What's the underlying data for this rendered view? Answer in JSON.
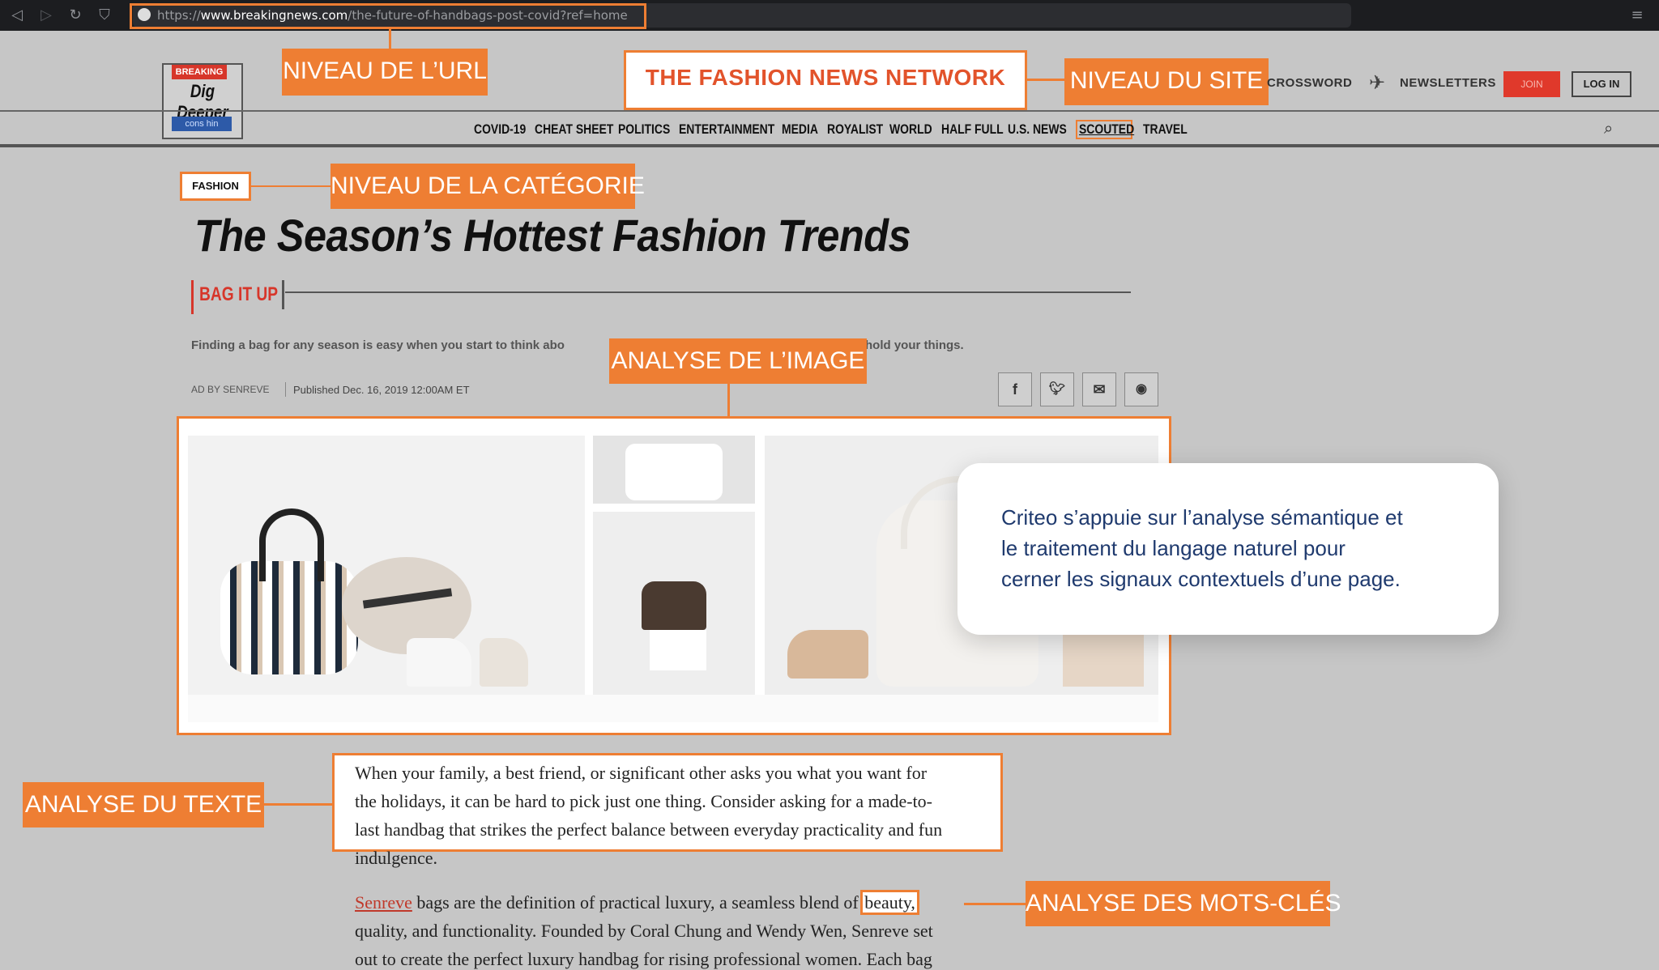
{
  "browser": {
    "url_prefix": "https://",
    "url_domain": "www.breakingnews.com",
    "url_path": "/the-future-of-handbags-post-covid?ref=home",
    "icons": [
      "back-icon",
      "forward-icon",
      "reload-icon",
      "bookmark-icon",
      "globe-icon",
      "menu-icon"
    ]
  },
  "logo": {
    "top": "BREAKING",
    "main": "Dig Deeper",
    "sub": "cons hin"
  },
  "header": {
    "site_name": "THE FASHION NEWS NETWORK",
    "crossword": "CROSSWORD",
    "newsletters": "NEWSLETTERS",
    "join": "JOIN",
    "login": "LOG IN"
  },
  "sections": [
    "COVID-19",
    "CHEAT SHEET",
    "POLITICS",
    "ENTERTAINMENT",
    "MEDIA",
    "ROYALIST",
    "WORLD",
    "HALF FULL",
    "U.S. NEWS",
    "SCOUTED",
    "TRAVEL"
  ],
  "article": {
    "category": "FASHION",
    "title": "The Season’s Hottest Fashion Trends",
    "rubric": "BAG IT UP",
    "dek_left": "Finding a bag for any season is easy when you start to think abo",
    "dek_right": "hold your things.",
    "ad_by": "AD BY SENREVE",
    "published": "Published Dec. 16, 2019 12:00AM ET",
    "para1_lines": [
      "When your family, a best friend, or significant other asks you what you want for",
      "the holidays, it can be hard to pick just one thing. Consider asking for a made-to-",
      "last handbag that strikes the perfect balance between everyday practicality and fun",
      "indulgence."
    ],
    "para2_link": "Senreve",
    "para2_line1_rest": " bags are the definition of practical luxury, a seamless blend of ",
    "para2_keyword": "beauty,",
    "para2_lines": [
      "quality, and functionality. Founded by Coral Chung and Wendy Wen, Senreve set",
      "out to create the perfect luxury handbag for rising professional women. Each bag"
    ]
  },
  "annotations": {
    "url_level": "NIVEAU DE L’URL",
    "site_level": "NIVEAU DU SITE",
    "category_level": "NIVEAU DE LA CATÉGORIE",
    "image_analysis": "ANALYSE DE L’IMAGE",
    "text_analysis": "ANALYSE DU TEXTE",
    "keyword_analysis": "ANALYSE DES MOTS-CLÉS"
  },
  "callout_lines": [
    "Criteo s’appuie sur l’analyse sémantique et",
    "le traitement du langage naturel pour",
    "cerner les signaux contextuels d’une page."
  ],
  "colors": {
    "accent": "#ee7e33",
    "callout_text": "#1f3a6e",
    "join": "#e0392b"
  }
}
